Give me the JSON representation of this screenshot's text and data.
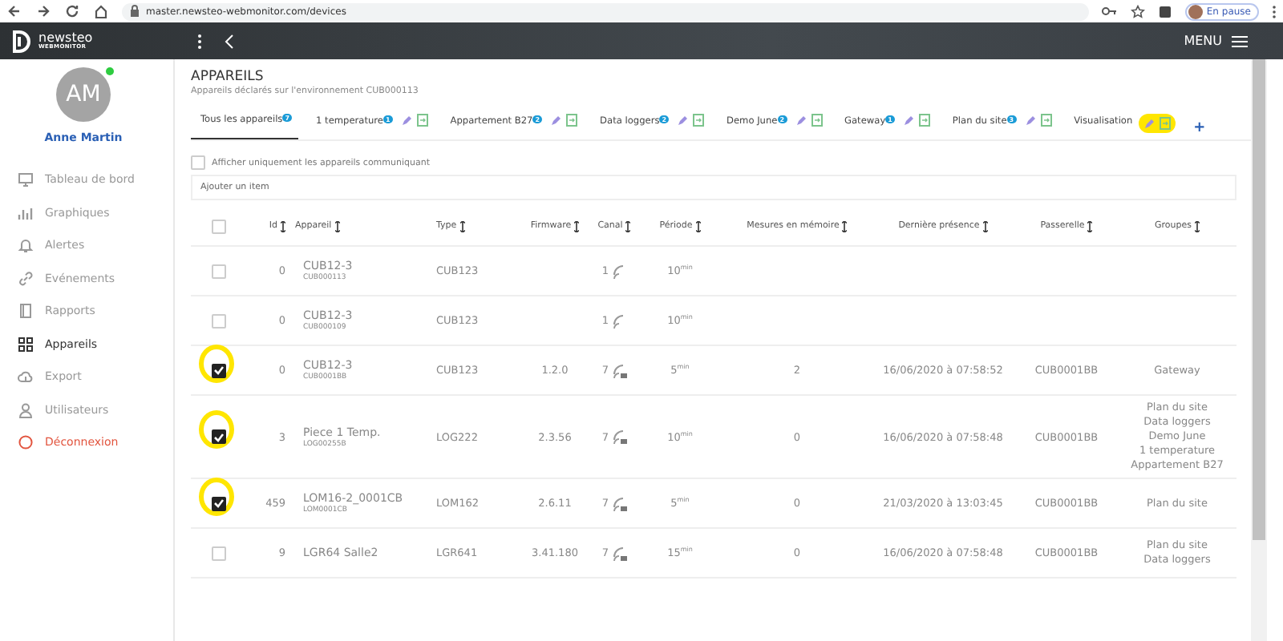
{
  "browser": {
    "address": "master.newsteo-webmonitor.com/devices",
    "profile_status": "En pause"
  },
  "header": {
    "logo": "newsteo",
    "logo_sub": "WEBMONITOR",
    "menu": "MENU"
  },
  "user": {
    "initials": "AM",
    "name": "Anne Martin",
    "online": true
  },
  "sidebar": {
    "items": [
      {
        "label": "Tableau de bord",
        "selected": false,
        "kind": "nav"
      },
      {
        "label": "Graphiques",
        "selected": false,
        "kind": "nav"
      },
      {
        "label": "Alertes",
        "selected": false,
        "kind": "nav"
      },
      {
        "label": "Evénements",
        "selected": false,
        "kind": "nav"
      },
      {
        "label": "Rapports",
        "selected": false,
        "kind": "nav"
      },
      {
        "label": "Appareils",
        "selected": true,
        "kind": "nav"
      },
      {
        "label": "Export",
        "selected": false,
        "kind": "nav"
      },
      {
        "label": "Utilisateurs",
        "selected": false,
        "kind": "nav"
      },
      {
        "label": "Déconnexion",
        "selected": false,
        "kind": "logout"
      }
    ]
  },
  "page": {
    "title": "APPAREILS",
    "subtitle": "Appareils déclarés sur l'environnement CUB000113"
  },
  "tabs": [
    {
      "label": "Tous les appareils",
      "count": "7",
      "editable": false,
      "selected": true,
      "highlighted": false
    },
    {
      "label": "1 temperature",
      "count": "1",
      "editable": true,
      "selected": false,
      "highlighted": false
    },
    {
      "label": "Appartement B27",
      "count": "2",
      "editable": true,
      "selected": false,
      "highlighted": false
    },
    {
      "label": "Data loggers",
      "count": "2",
      "editable": true,
      "selected": false,
      "highlighted": false
    },
    {
      "label": "Demo June",
      "count": "2",
      "editable": true,
      "selected": false,
      "highlighted": false
    },
    {
      "label": "Gateway",
      "count": "1",
      "editable": true,
      "selected": false,
      "highlighted": false
    },
    {
      "label": "Plan du site",
      "count": "3",
      "editable": true,
      "selected": false,
      "highlighted": false
    },
    {
      "label": "Visualisation",
      "editable": true,
      "selected": false,
      "highlighted": true
    }
  ],
  "add_tab": "+",
  "filter": {
    "label": "Afficher uniquement les appareils communiquant",
    "checked": false
  },
  "add_item": {
    "placeholder": "Ajouter un item"
  },
  "table": {
    "select_all": false,
    "columns": [
      "Id",
      "Appareil",
      "Type",
      "Firmware",
      "Canal",
      "Période",
      "Mesures en mémoire",
      "Dernière présence",
      "Passerelle",
      "Groupes"
    ],
    "rows": [
      {
        "checked": false,
        "highlighted": false,
        "id": "0",
        "name": "CUB12-3",
        "serial": "CUB000113",
        "type": "CUB123",
        "canal": "1",
        "battery": false,
        "period": "10$^{min}$",
        "groups": []
      },
      {
        "checked": false,
        "highlighted": false,
        "id": "0",
        "name": "CUB12-3",
        "serial": "CUB000109",
        "type": "CUB123",
        "canal": "1",
        "battery": false,
        "period": "10$^{min}$",
        "groups": []
      },
      {
        "checked": true,
        "highlighted": true,
        "id": "0",
        "name": "CUB12-3",
        "serial": "CUB0001BB",
        "type": "CUB123",
        "firmware": "1.2.0",
        "canal": "7",
        "battery": true,
        "period": "5$^{min}$",
        "measures": "2",
        "last_seen": "16/06/2020 à 07:58:52",
        "gateway": "CUB0001BB",
        "groups": [
          "Gateway"
        ]
      },
      {
        "checked": true,
        "highlighted": true,
        "id": "3",
        "name": "Piece 1 Temp.",
        "serial": "LOG00255B",
        "type": "LOG222",
        "firmware": "2.3.56",
        "canal": "7",
        "battery": true,
        "period": "10$^{min}$",
        "measures": "0",
        "last_seen": "16/06/2020 à 07:58:48",
        "gateway": "CUB0001BB",
        "groups": [
          "Plan du site",
          "Data loggers",
          "Demo June",
          "1 temperature",
          "Appartement B27"
        ]
      },
      {
        "checked": true,
        "highlighted": true,
        "id": "459",
        "name": "LOM16-2_0001CB",
        "serial": "LOM0001CB",
        "type": "LOM162",
        "firmware": "2.6.11",
        "canal": "7",
        "battery": true,
        "period": "5$^{min}$",
        "measures": "0",
        "last_seen": "21/03/2020 à 13:03:45",
        "gateway": "CUB0001BB",
        "groups": [
          "Plan du site"
        ]
      },
      {
        "checked": false,
        "highlighted": false,
        "id": "9",
        "name": "LGR64 Salle2",
        "type": "LGR641",
        "firmware": "3.41.180",
        "canal": "7",
        "battery": true,
        "period": "15$^{min}$",
        "measures": "0",
        "last_seen": "16/06/2020 à 07:58:48",
        "gateway": "CUB0001BB",
        "groups": [
          "Plan du site",
          "Data loggers"
        ]
      }
    ]
  }
}
